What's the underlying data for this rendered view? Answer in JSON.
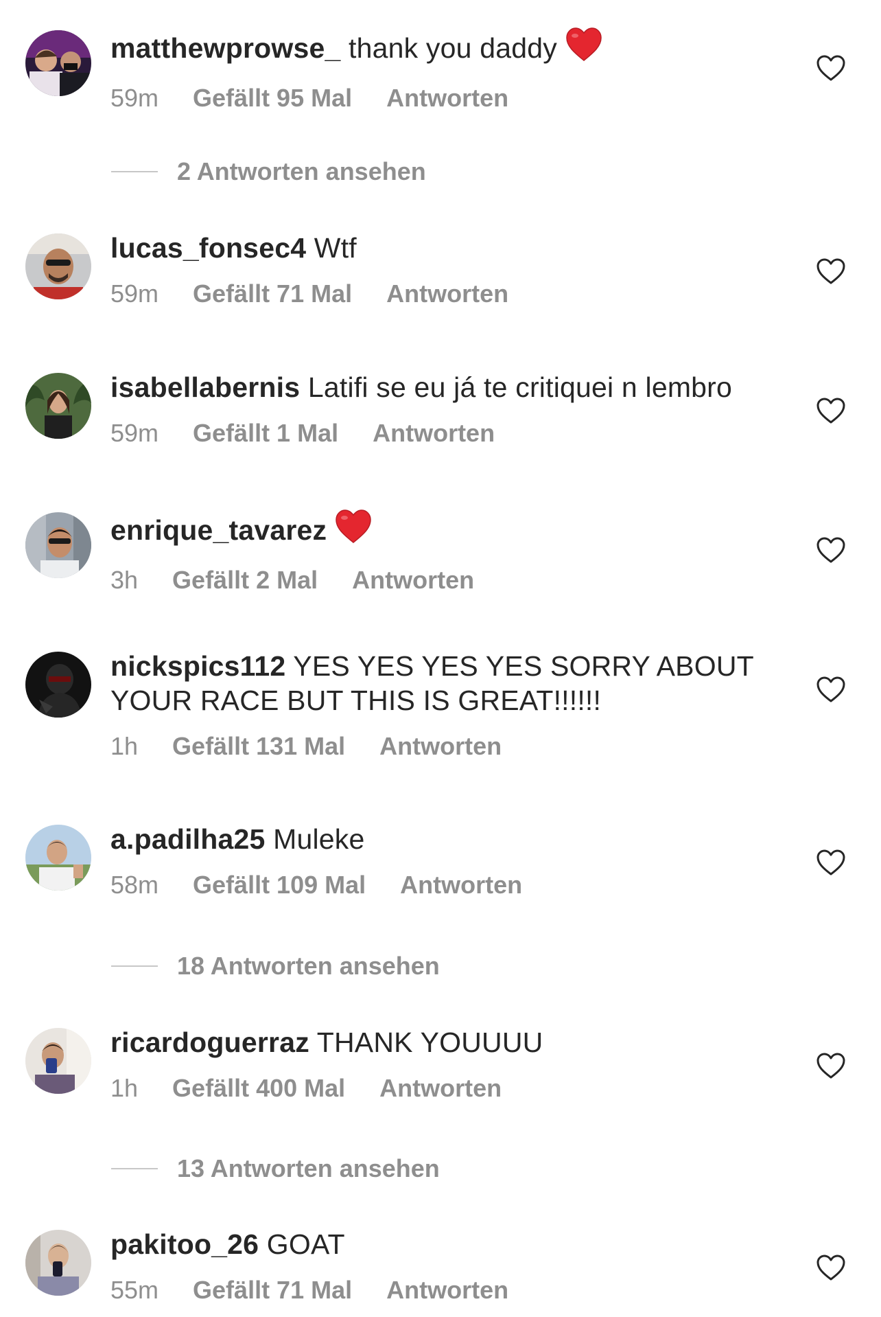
{
  "comments": [
    {
      "username": "matthewprowse_",
      "text": " thank you daddy",
      "emoji": "heart-emoji",
      "time": "59m",
      "likes": "Gefällt 95 Mal",
      "reply": "Antworten",
      "view_replies": "2 Antworten ansehen"
    },
    {
      "username": "lucas_fonsec4",
      "text": " Wtf",
      "time": "59m",
      "likes": "Gefällt 71 Mal",
      "reply": "Antworten"
    },
    {
      "username": "isabellabernis",
      "text": " Latifi se eu já te critiquei n lembro",
      "time": "59m",
      "likes": "Gefällt 1 Mal",
      "reply": "Antworten"
    },
    {
      "username": "enrique_tavarez",
      "text": "",
      "emoji": "heart-emoji",
      "time": "3h",
      "likes": "Gefällt 2 Mal",
      "reply": "Antworten"
    },
    {
      "username": "nickspics112",
      "text": " YES YES YES YES SORRY ABOUT",
      "text2": "YOUR RACE BUT THIS IS GREAT!!!!!!",
      "time": "1h",
      "likes": "Gefällt 131 Mal",
      "reply": "Antworten"
    },
    {
      "username": "a.padilha25",
      "text": " Muleke",
      "time": "58m",
      "likes": "Gefällt 109 Mal",
      "reply": "Antworten",
      "view_replies": "18 Antworten ansehen"
    },
    {
      "username": "ricardoguerraz",
      "text": " THANK YOUUUU",
      "time": "1h",
      "likes": "Gefällt 400 Mal",
      "reply": "Antworten",
      "view_replies": "13 Antworten ansehen"
    },
    {
      "username": "pakitoo_26",
      "text": " GOAT",
      "time": "55m",
      "likes": "Gefällt 71 Mal",
      "reply": "Antworten"
    }
  ],
  "icons": {
    "like": "heart-outline-icon",
    "emoji": "red-heart-emoji"
  },
  "colors": {
    "text": "#262626",
    "secondary": "#8e8e8e",
    "heart_emoji": "#e4262f"
  }
}
